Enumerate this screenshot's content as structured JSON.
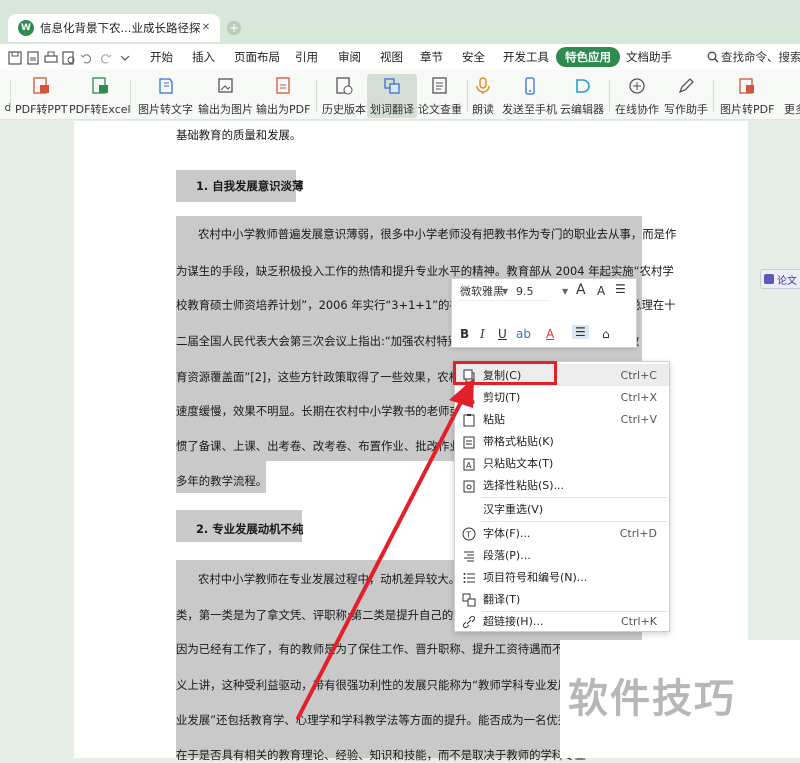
{
  "colors": {
    "accent": "#2e8b4f",
    "annotation": "#e3202a",
    "selection": "#c9c9c9"
  },
  "tab": {
    "title": "信息化背景下农...业成长路径探析",
    "logo_text": "W",
    "close": "✕",
    "new_tab": "+"
  },
  "menu": [
    {
      "label": "开始"
    },
    {
      "label": "插入"
    },
    {
      "label": "页面布局"
    },
    {
      "label": "引用"
    },
    {
      "label": "审阅"
    },
    {
      "label": "视图"
    },
    {
      "label": "章节"
    },
    {
      "label": "安全"
    },
    {
      "label": "开发工具"
    },
    {
      "label": "特色应用",
      "active": true
    },
    {
      "label": "文档助手"
    }
  ],
  "search": {
    "label": "查找命令、搜索"
  },
  "ribbon": [
    {
      "label": "d",
      "icon": "partial-icon"
    },
    {
      "label": "PDF转PPT",
      "icon": "pdf-to-ppt-icon"
    },
    {
      "label": "PDF转Excel",
      "icon": "pdf-to-excel-icon"
    },
    {
      "label": "图片转文字",
      "icon": "image-to-text-icon"
    },
    {
      "label": "输出为图片",
      "icon": "export-image-icon"
    },
    {
      "label": "输出为PDF",
      "icon": "export-pdf-icon"
    },
    {
      "label": "历史版本",
      "icon": "history-icon"
    },
    {
      "label": "划词翻译",
      "icon": "translate-icon",
      "active": true
    },
    {
      "label": "论文查重",
      "icon": "plagiarism-icon"
    },
    {
      "label": "朗读",
      "icon": "read-aloud-icon"
    },
    {
      "label": "发送至手机",
      "icon": "send-phone-icon"
    },
    {
      "label": "云编辑器",
      "icon": "cloud-editor-icon"
    },
    {
      "label": "在线协作",
      "icon": "collaborate-icon"
    },
    {
      "label": "写作助手",
      "icon": "writing-icon"
    },
    {
      "label": "图片转PDF",
      "icon": "image-to-pdf-icon"
    },
    {
      "label": "更多",
      "icon": "more-icon"
    }
  ],
  "doc": {
    "lines": [
      "基础教育的质量和发展。",
      "1. 自我发展意识淡薄",
      "农村中小学教师普遍发展意识薄弱，很多中小学老师没有把教书作为专门的职业去从事，而是作",
      "为谋生的手段，缺乏积极投入工作的热情和提升专业水平的精神。教育部从 2004 年起实施“农村学",
      "校教育硕士师资培养计划”，2006 年实行“3+1+1”的在职硕士培养模式。2015 年李克强总理在十",
      "二届全国人民代表大会第三次会议上指出:“加强农村特别是",
      "育资源覆盖面”[2]，这些方针政策取得了一些效果，农村教",
      "速度缓慢，效果不明显。长期在农村中小学教书的老师或多少",
      "惯了备课、上课、出考卷、改考卷、布置作业、批改作业的",
      "多年的教学流程。",
      "2. 专业发展动机不纯",
      "农村中小学教师在专业发展过程中，动机差异较大。农",
      "类，第一类是为了拿文凭、评职称;第二类是提升自己的专业",
      "因为已经有工作了，有的教师是为了保住工作、晋升职称、提升工资待遇而不得已",
      "义上讲，这种受利益驱动，带有很强功利性的发展只能称为“教师学科专业发展”，",
      "业发展”还包括教育学、心理学和学科教学法等方面的提升。能否成为一名优秀的",
      "在于是否具有相关的教育理论、经验、知识和技能，而不是取决于教师的学科专业"
    ],
    "right_frags": [
      "教",
      "教",
      "要",
      "专",
      "较"
    ],
    "side_button": "论文"
  },
  "mini_toolbar": {
    "font": "微软雅黑",
    "size": "9.5",
    "grow": "A",
    "shrink": "A"
  },
  "context_menu": [
    {
      "label": "复制(C)",
      "shortcut": "Ctrl+C",
      "icon": "copy-icon"
    },
    {
      "label": "剪切(T)",
      "shortcut": "Ctrl+X",
      "icon": "scissors-icon"
    },
    {
      "label": "粘贴",
      "shortcut": "Ctrl+V",
      "icon": "paste-icon"
    },
    {
      "label": "带格式粘贴(K)",
      "shortcut": "",
      "icon": "paste-format-icon"
    },
    {
      "label": "只粘贴文本(T)",
      "shortcut": "",
      "icon": "paste-text-icon"
    },
    {
      "label": "选择性粘贴(S)...",
      "shortcut": "",
      "icon": "paste-special-icon"
    },
    {
      "label": "汉字重选(V)",
      "shortcut": "",
      "icon": ""
    },
    {
      "label": "字体(F)...",
      "shortcut": "Ctrl+D",
      "icon": "font-icon"
    },
    {
      "label": "段落(P)...",
      "shortcut": "",
      "icon": "paragraph-icon"
    },
    {
      "label": "项目符号和编号(N)...",
      "shortcut": "",
      "icon": "list-icon"
    },
    {
      "label": "翻译(T)",
      "shortcut": "",
      "icon": "translate-icon"
    },
    {
      "label": "超链接(H)...",
      "shortcut": "Ctrl+K",
      "icon": "link-icon"
    }
  ],
  "watermark": "软件技巧"
}
